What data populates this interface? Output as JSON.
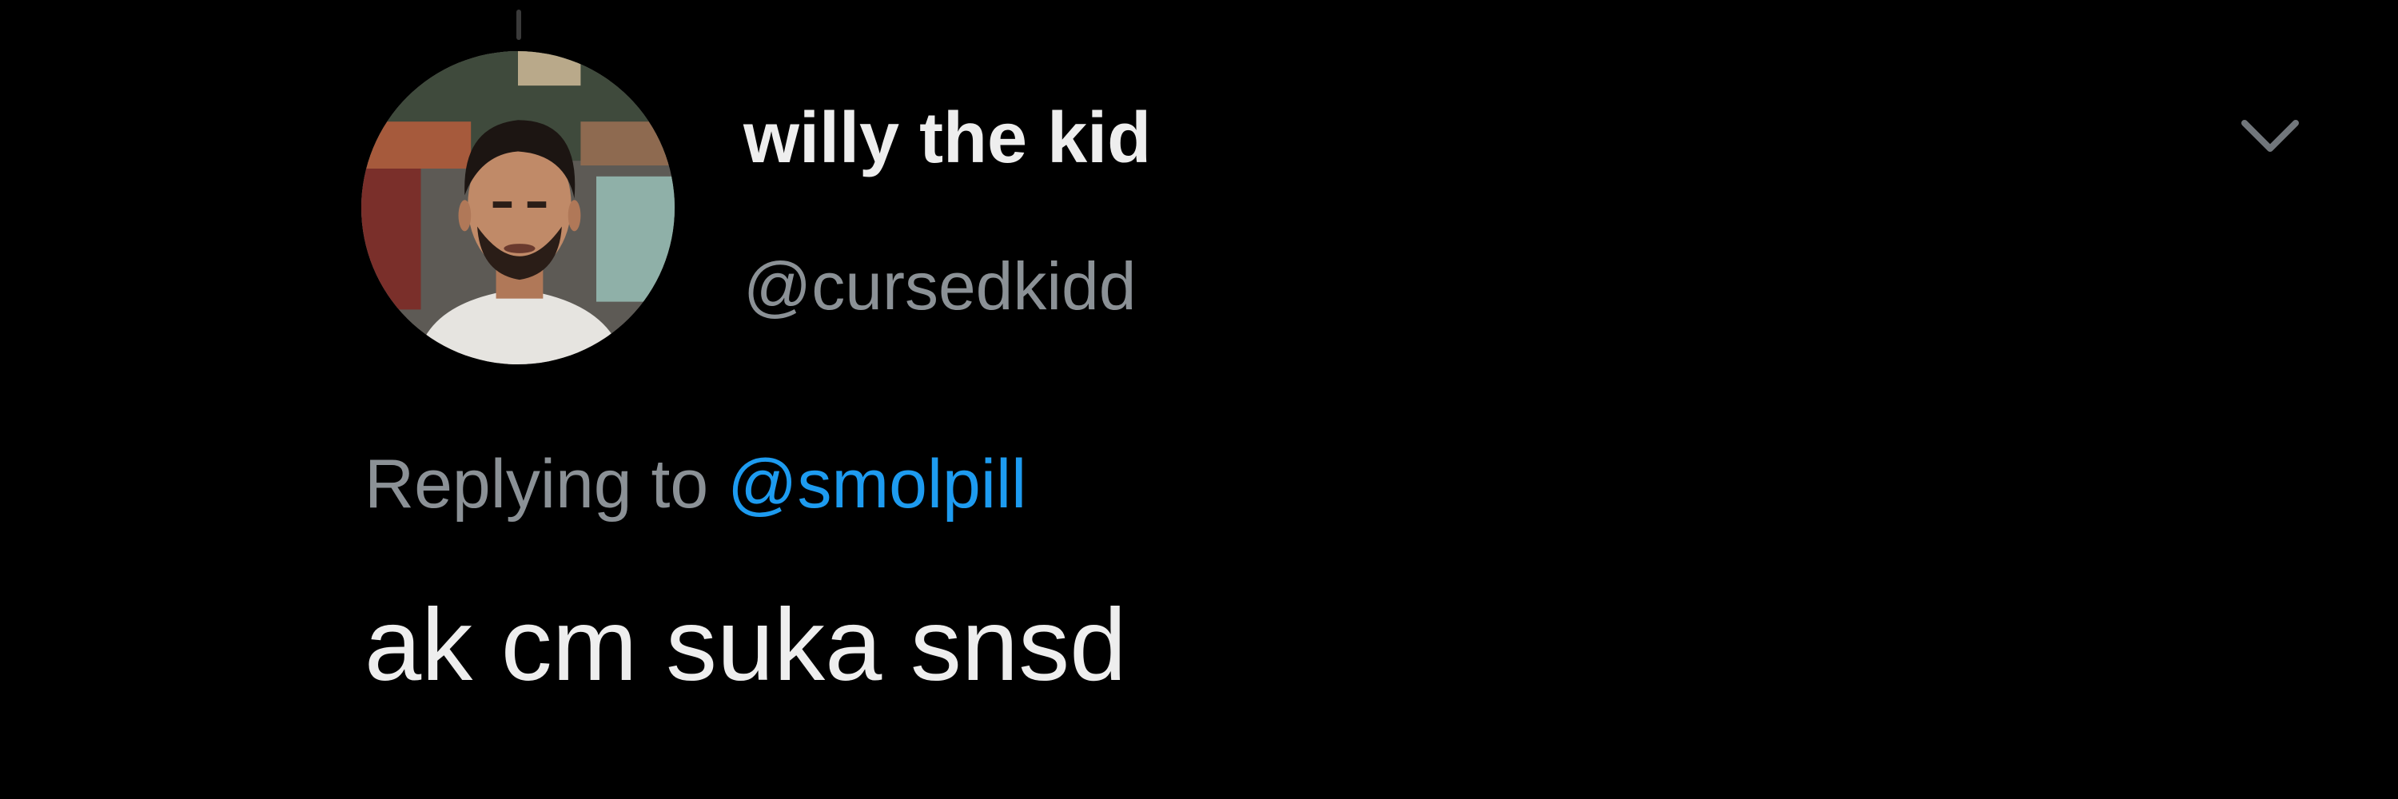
{
  "tweet": {
    "author": {
      "display_name": "willy the kid",
      "handle": "@cursedkidd",
      "avatar_icon": "profile-photo"
    },
    "reply": {
      "prefix": "Replying to",
      "handle": "@smolpill"
    },
    "text": "ak cm suka snsd",
    "menu_icon": "chevron-down-icon"
  },
  "colors": {
    "background": "#000000",
    "primary_text": "#eeeeee",
    "secondary_text": "#8b9196",
    "link": "#1d9bf0"
  }
}
